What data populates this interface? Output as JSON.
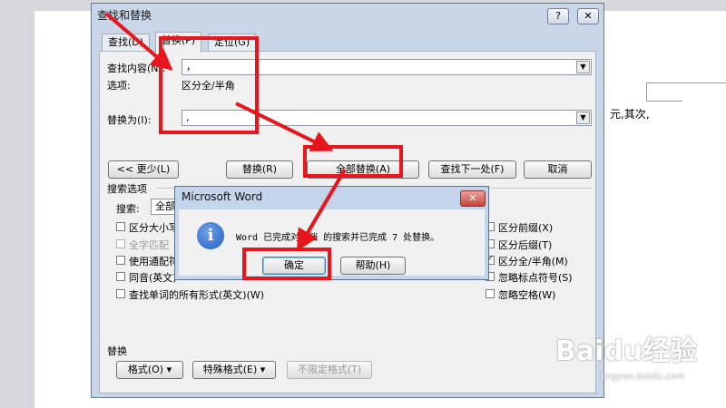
{
  "document": {
    "body_text": "元,其次,"
  },
  "dialog": {
    "title": "查找和替换",
    "help_label": "?",
    "close_label": "✕",
    "tabs": [
      {
        "label": "查找(D)"
      },
      {
        "label": "替换(P)"
      },
      {
        "label": "定位(G)"
      }
    ],
    "find_label": "查找内容(N):",
    "find_value": "，",
    "options_label": "选项:",
    "options_value": "区分全/半角",
    "replace_label": "替换为(I):",
    "replace_value": ",",
    "buttons": {
      "less": "<< 更少(L)",
      "replace": "替换(R)",
      "replace_all": "全部替换(A)",
      "find_next": "查找下一处(F)",
      "cancel": "取消"
    },
    "search_options_title": "搜索选项",
    "search_label": "搜索:",
    "search_value": "全部",
    "left_checks": [
      {
        "label": "区分大小写",
        "checked": false,
        "disabled": false
      },
      {
        "label": "全字匹配",
        "checked": false,
        "disabled": true
      },
      {
        "label": "使用通配符",
        "checked": false,
        "disabled": false
      },
      {
        "label": "同音(英文)",
        "checked": false,
        "disabled": false
      },
      {
        "label": "查找单词的所有形式(英文)(W)",
        "checked": false,
        "disabled": false
      }
    ],
    "right_checks": [
      {
        "label": "区分前缀(X)",
        "checked": false
      },
      {
        "label": "区分后缀(T)",
        "checked": false
      },
      {
        "label": "区分全/半角(M)",
        "checked": true
      },
      {
        "label": "忽略标点符号(S)",
        "checked": false
      },
      {
        "label": "忽略空格(W)",
        "checked": false
      }
    ],
    "replace_section_title": "替换",
    "format_buttons": {
      "format": "格式(O) ▾",
      "special": "特殊格式(E) ▾",
      "no_format": "不限定格式(T)"
    }
  },
  "message_box": {
    "title": "Microsoft Word",
    "close_label": "✕",
    "icon": "info-icon",
    "icon_glyph": "i",
    "message": "Word 已完成对文档 的搜索并已完成 7 处替换。",
    "ok_label": "确定",
    "help_label": "帮助(H)"
  },
  "watermark": {
    "brand": "Baidu经验",
    "url": "jingyan.baidu.com"
  },
  "annotation_color": "#e8161c"
}
